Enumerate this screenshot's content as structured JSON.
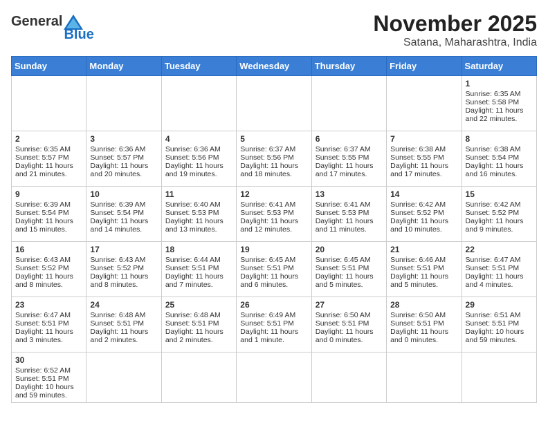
{
  "header": {
    "logo_general": "General",
    "logo_blue": "Blue",
    "month_year": "November 2025",
    "location": "Satana, Maharashtra, India"
  },
  "weekdays": [
    "Sunday",
    "Monday",
    "Tuesday",
    "Wednesday",
    "Thursday",
    "Friday",
    "Saturday"
  ],
  "weeks": [
    [
      {
        "day": "",
        "content": ""
      },
      {
        "day": "",
        "content": ""
      },
      {
        "day": "",
        "content": ""
      },
      {
        "day": "",
        "content": ""
      },
      {
        "day": "",
        "content": ""
      },
      {
        "day": "",
        "content": ""
      },
      {
        "day": "1",
        "content": "Sunrise: 6:35 AM\nSunset: 5:58 PM\nDaylight: 11 hours and 22 minutes."
      }
    ],
    [
      {
        "day": "2",
        "content": "Sunrise: 6:35 AM\nSunset: 5:57 PM\nDaylight: 11 hours and 21 minutes."
      },
      {
        "day": "3",
        "content": "Sunrise: 6:36 AM\nSunset: 5:57 PM\nDaylight: 11 hours and 20 minutes."
      },
      {
        "day": "4",
        "content": "Sunrise: 6:36 AM\nSunset: 5:56 PM\nDaylight: 11 hours and 19 minutes."
      },
      {
        "day": "5",
        "content": "Sunrise: 6:37 AM\nSunset: 5:56 PM\nDaylight: 11 hours and 18 minutes."
      },
      {
        "day": "6",
        "content": "Sunrise: 6:37 AM\nSunset: 5:55 PM\nDaylight: 11 hours and 17 minutes."
      },
      {
        "day": "7",
        "content": "Sunrise: 6:38 AM\nSunset: 5:55 PM\nDaylight: 11 hours and 17 minutes."
      },
      {
        "day": "8",
        "content": "Sunrise: 6:38 AM\nSunset: 5:54 PM\nDaylight: 11 hours and 16 minutes."
      }
    ],
    [
      {
        "day": "9",
        "content": "Sunrise: 6:39 AM\nSunset: 5:54 PM\nDaylight: 11 hours and 15 minutes."
      },
      {
        "day": "10",
        "content": "Sunrise: 6:39 AM\nSunset: 5:54 PM\nDaylight: 11 hours and 14 minutes."
      },
      {
        "day": "11",
        "content": "Sunrise: 6:40 AM\nSunset: 5:53 PM\nDaylight: 11 hours and 13 minutes."
      },
      {
        "day": "12",
        "content": "Sunrise: 6:41 AM\nSunset: 5:53 PM\nDaylight: 11 hours and 12 minutes."
      },
      {
        "day": "13",
        "content": "Sunrise: 6:41 AM\nSunset: 5:53 PM\nDaylight: 11 hours and 11 minutes."
      },
      {
        "day": "14",
        "content": "Sunrise: 6:42 AM\nSunset: 5:52 PM\nDaylight: 11 hours and 10 minutes."
      },
      {
        "day": "15",
        "content": "Sunrise: 6:42 AM\nSunset: 5:52 PM\nDaylight: 11 hours and 9 minutes."
      }
    ],
    [
      {
        "day": "16",
        "content": "Sunrise: 6:43 AM\nSunset: 5:52 PM\nDaylight: 11 hours and 8 minutes."
      },
      {
        "day": "17",
        "content": "Sunrise: 6:43 AM\nSunset: 5:52 PM\nDaylight: 11 hours and 8 minutes."
      },
      {
        "day": "18",
        "content": "Sunrise: 6:44 AM\nSunset: 5:51 PM\nDaylight: 11 hours and 7 minutes."
      },
      {
        "day": "19",
        "content": "Sunrise: 6:45 AM\nSunset: 5:51 PM\nDaylight: 11 hours and 6 minutes."
      },
      {
        "day": "20",
        "content": "Sunrise: 6:45 AM\nSunset: 5:51 PM\nDaylight: 11 hours and 5 minutes."
      },
      {
        "day": "21",
        "content": "Sunrise: 6:46 AM\nSunset: 5:51 PM\nDaylight: 11 hours and 5 minutes."
      },
      {
        "day": "22",
        "content": "Sunrise: 6:47 AM\nSunset: 5:51 PM\nDaylight: 11 hours and 4 minutes."
      }
    ],
    [
      {
        "day": "23",
        "content": "Sunrise: 6:47 AM\nSunset: 5:51 PM\nDaylight: 11 hours and 3 minutes."
      },
      {
        "day": "24",
        "content": "Sunrise: 6:48 AM\nSunset: 5:51 PM\nDaylight: 11 hours and 2 minutes."
      },
      {
        "day": "25",
        "content": "Sunrise: 6:48 AM\nSunset: 5:51 PM\nDaylight: 11 hours and 2 minutes."
      },
      {
        "day": "26",
        "content": "Sunrise: 6:49 AM\nSunset: 5:51 PM\nDaylight: 11 hours and 1 minute."
      },
      {
        "day": "27",
        "content": "Sunrise: 6:50 AM\nSunset: 5:51 PM\nDaylight: 11 hours and 0 minutes."
      },
      {
        "day": "28",
        "content": "Sunrise: 6:50 AM\nSunset: 5:51 PM\nDaylight: 11 hours and 0 minutes."
      },
      {
        "day": "29",
        "content": "Sunrise: 6:51 AM\nSunset: 5:51 PM\nDaylight: 10 hours and 59 minutes."
      }
    ],
    [
      {
        "day": "30",
        "content": "Sunrise: 6:52 AM\nSunset: 5:51 PM\nDaylight: 10 hours and 59 minutes."
      },
      {
        "day": "",
        "content": ""
      },
      {
        "day": "",
        "content": ""
      },
      {
        "day": "",
        "content": ""
      },
      {
        "day": "",
        "content": ""
      },
      {
        "day": "",
        "content": ""
      },
      {
        "day": "",
        "content": ""
      }
    ]
  ]
}
